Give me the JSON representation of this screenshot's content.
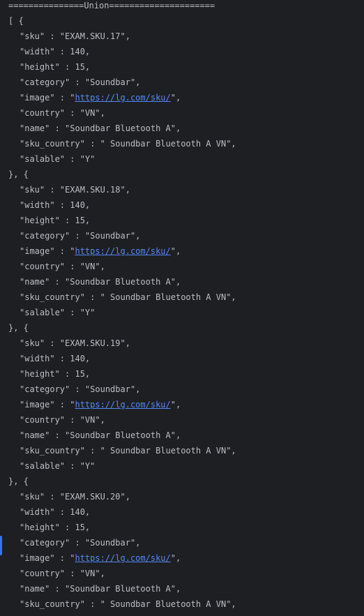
{
  "separator": "===============Union=====================",
  "open_array": "[ {",
  "object_separator": "}, {",
  "records": [
    {
      "sku": "\"sku\" : \"EXAM.SKU.17\",",
      "width": "\"width\" : 140,",
      "height": "\"height\" : 15,",
      "category": "\"category\" : \"Soundbar\",",
      "image_prefix": "\"image\" : \"",
      "image_url": "https://lg.com/sku/",
      "image_suffix": "\",",
      "country": "\"country\" : \"VN\",",
      "name": "\"name\" : \"Soundbar Bluetooth A\",",
      "sku_country": "\"sku_country\" : \" Soundbar Bluetooth A VN\",",
      "salable": "\"salable\" : \"Y\""
    },
    {
      "sku": "\"sku\" : \"EXAM.SKU.18\",",
      "width": "\"width\" : 140,",
      "height": "\"height\" : 15,",
      "category": "\"category\" : \"Soundbar\",",
      "image_prefix": "\"image\" : \"",
      "image_url": "https://lg.com/sku/",
      "image_suffix": "\",",
      "country": "\"country\" : \"VN\",",
      "name": "\"name\" : \"Soundbar Bluetooth A\",",
      "sku_country": "\"sku_country\" : \" Soundbar Bluetooth A VN\",",
      "salable": "\"salable\" : \"Y\""
    },
    {
      "sku": "\"sku\" : \"EXAM.SKU.19\",",
      "width": "\"width\" : 140,",
      "height": "\"height\" : 15,",
      "category": "\"category\" : \"Soundbar\",",
      "image_prefix": "\"image\" : \"",
      "image_url": "https://lg.com/sku/",
      "image_suffix": "\",",
      "country": "\"country\" : \"VN\",",
      "name": "\"name\" : \"Soundbar Bluetooth A\",",
      "sku_country": "\"sku_country\" : \" Soundbar Bluetooth A VN\",",
      "salable": "\"salable\" : \"Y\""
    },
    {
      "sku": "\"sku\" : \"EXAM.SKU.20\",",
      "width": "\"width\" : 140,",
      "height": "\"height\" : 15,",
      "category": "\"category\" : \"Soundbar\",",
      "image_prefix": "\"image\" : \"",
      "image_url": "https://lg.com/sku/",
      "image_suffix": "\",",
      "country": "\"country\" : \"VN\",",
      "name": "\"name\" : \"Soundbar Bluetooth A\",",
      "sku_country": "\"sku_country\" : \" Soundbar Bluetooth A VN\","
    }
  ],
  "colors": {
    "background": "#1e1f22",
    "text": "#bcbec4",
    "link": "#548af7",
    "gutter_marker": "#3574f0"
  }
}
